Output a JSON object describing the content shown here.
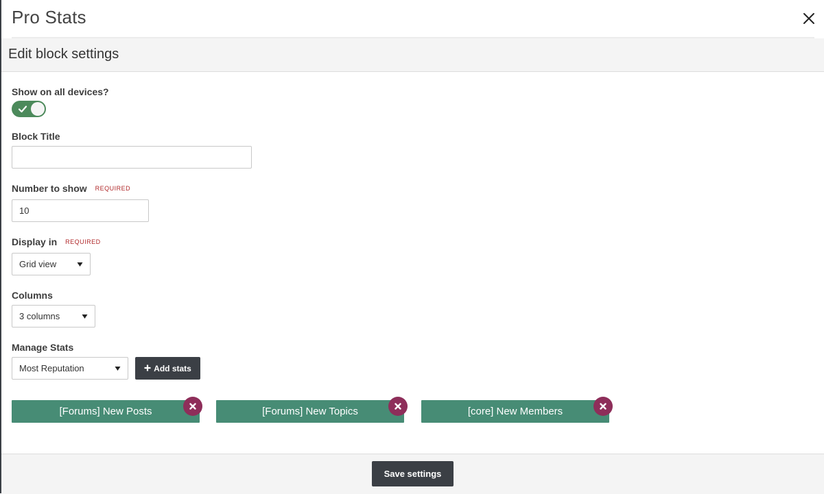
{
  "modal": {
    "title": "Pro Stats",
    "close_icon": "close-icon"
  },
  "header": {
    "title": "Edit block settings"
  },
  "form": {
    "show_all_devices": {
      "label": "Show on all devices?",
      "enabled": true,
      "icon": "check-icon",
      "color": "#4c8a5b"
    },
    "block_title": {
      "label": "Block Title",
      "value": "",
      "placeholder": ""
    },
    "number_to_show": {
      "label": "Number to show",
      "required_label": "REQUIRED",
      "value": "10"
    },
    "display_in": {
      "label": "Display in",
      "required_label": "REQUIRED",
      "selected": "Grid view"
    },
    "columns": {
      "label": "Columns",
      "selected": "3 columns"
    },
    "manage_stats": {
      "label": "Manage Stats",
      "selected": "Most Reputation",
      "add_button_label": "Add stats",
      "add_icon": "plus-icon"
    }
  },
  "stats": [
    {
      "label": "[Forums] New Posts"
    },
    {
      "label": "[Forums] New Topics"
    },
    {
      "label": "[core] New Members"
    }
  ],
  "colors": {
    "chip": "#478c75",
    "remove": "#8e2e5a",
    "button": "#3b3f45",
    "required": "#b0282a"
  },
  "footer": {
    "save_label": "Save settings"
  }
}
